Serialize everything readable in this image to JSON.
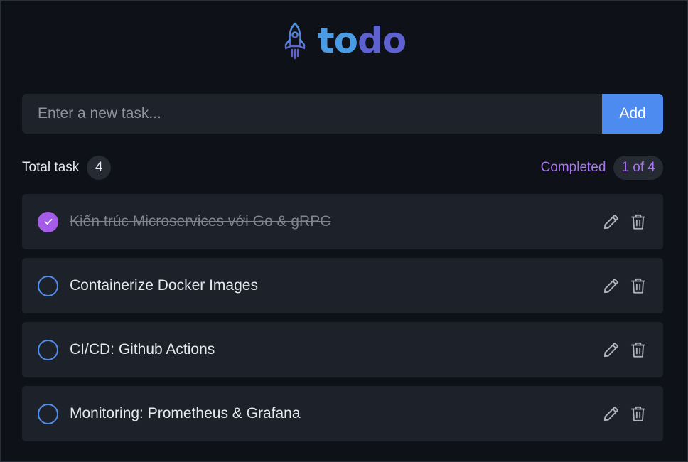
{
  "app": {
    "logo_text_part1": "to",
    "logo_text_part2": "do",
    "logo_icon": "rocket-icon"
  },
  "add_form": {
    "placeholder": "Enter a new task...",
    "value": "",
    "button_label": "Add"
  },
  "stats": {
    "total_label": "Total task",
    "total_count": "4",
    "completed_label": "Completed",
    "completed_count": "1 of 4"
  },
  "tasks": [
    {
      "title": "Kiến trúc Microservices với Go & gRPC",
      "completed": true
    },
    {
      "title": "Containerize Docker Images",
      "completed": false
    },
    {
      "title": "CI/CD: Github Actions",
      "completed": false
    },
    {
      "title": "Monitoring: Prometheus & Grafana",
      "completed": false
    }
  ],
  "icons": {
    "edit": "pencil-icon",
    "delete": "trash-icon",
    "check": "checkmark-icon"
  },
  "colors": {
    "accent_blue": "#4d8bf0",
    "accent_purple": "#a45ce9",
    "background": "#0e1118",
    "card": "#1d212a"
  }
}
